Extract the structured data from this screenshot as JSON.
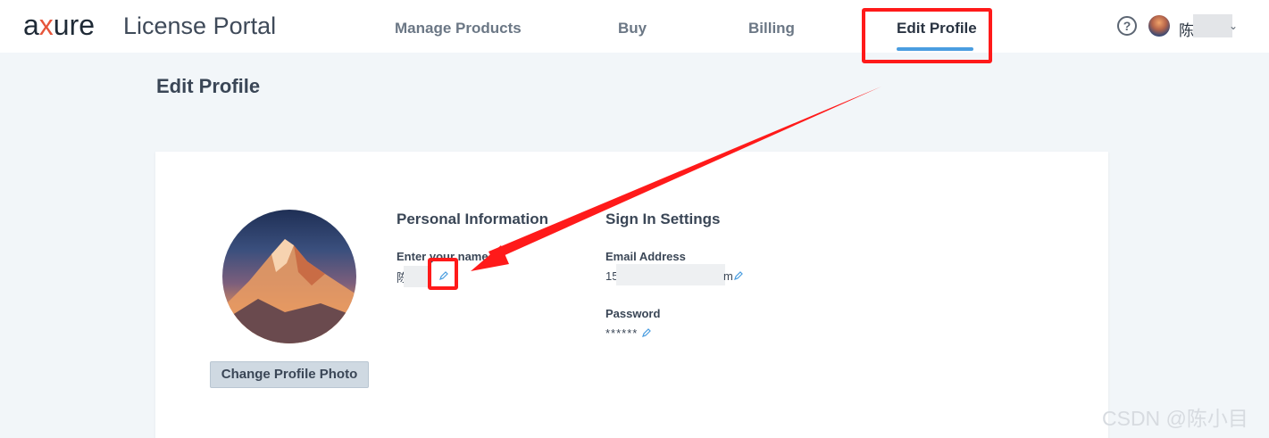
{
  "header": {
    "logo_text_a": "a",
    "logo_text_x": "x",
    "logo_text_rest": "ure",
    "portal_title": "License Portal",
    "nav": {
      "manage_products": "Manage Products",
      "buy": "Buy",
      "billing": "Billing",
      "edit_profile": "Edit Profile"
    },
    "help_label": "?",
    "user_name_first_char": "陈",
    "chevron_icon": "chevron-down-icon"
  },
  "page": {
    "title": "Edit Profile"
  },
  "profile": {
    "change_photo_label": "Change Profile Photo"
  },
  "personal_info": {
    "title": "Personal Information",
    "name_label": "Enter your name",
    "name_value_visible": "陈"
  },
  "sign_in": {
    "title": "Sign In Settings",
    "email_label": "Email Address",
    "email_value_visible_prefix": "15",
    "email_value_visible_suffix": "m",
    "password_label": "Password",
    "password_value": "******"
  },
  "annotations": {
    "highlight_color": "#ff1a1a",
    "arrow_color": "#ff1a1a"
  },
  "colors": {
    "accent_underline": "#4a9de0",
    "logo_x_color": "#e6553a"
  },
  "watermark": {
    "text": "CSDN @陈小目"
  }
}
